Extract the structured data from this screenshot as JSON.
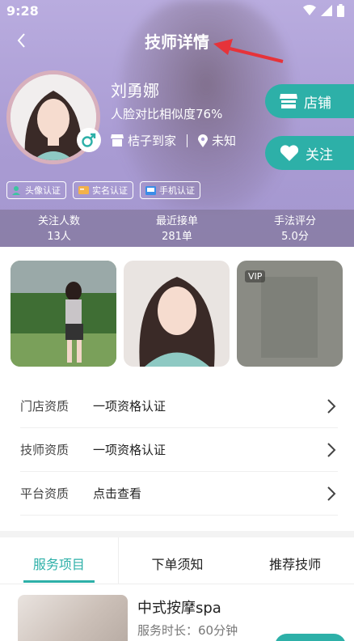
{
  "status_bar": {
    "time": "9:28"
  },
  "header": {
    "title": "技师详情",
    "name": "刘勇娜",
    "similarity": "人脸对比相似度76%",
    "store": "桔子到家",
    "location": "未知",
    "shop_button": "店铺",
    "follow_button": "关注",
    "certs": [
      "头像认证",
      "实名认证",
      "手机认证"
    ],
    "stats": [
      {
        "label": "关注人数",
        "value": "13人"
      },
      {
        "label": "最近接单",
        "value": "281单"
      },
      {
        "label": "手法评分",
        "value": "5.0分"
      }
    ]
  },
  "photos": {
    "vip_label": "VIP"
  },
  "qualifications": [
    {
      "key": "门店资质",
      "value": "一项资格认证"
    },
    {
      "key": "技师资质",
      "value": "一项资格认证"
    },
    {
      "key": "平台资质",
      "value": "点击查看"
    }
  ],
  "tabs": [
    "服务项目",
    "下单须知",
    "推荐技师"
  ],
  "service": {
    "name": "中式按摩spa",
    "duration": "服务时长：60分钟"
  },
  "colors": {
    "accent": "#2db0a8",
    "header_bg": "#b0a3d8"
  },
  "icons": [
    "back-icon",
    "wifi-icon",
    "signal-icon",
    "battery-icon",
    "male-icon",
    "store-icon",
    "location-icon",
    "shop-icon",
    "heart-icon",
    "user-check-icon",
    "id-card-icon",
    "phone-icon",
    "chevron-right-icon"
  ]
}
